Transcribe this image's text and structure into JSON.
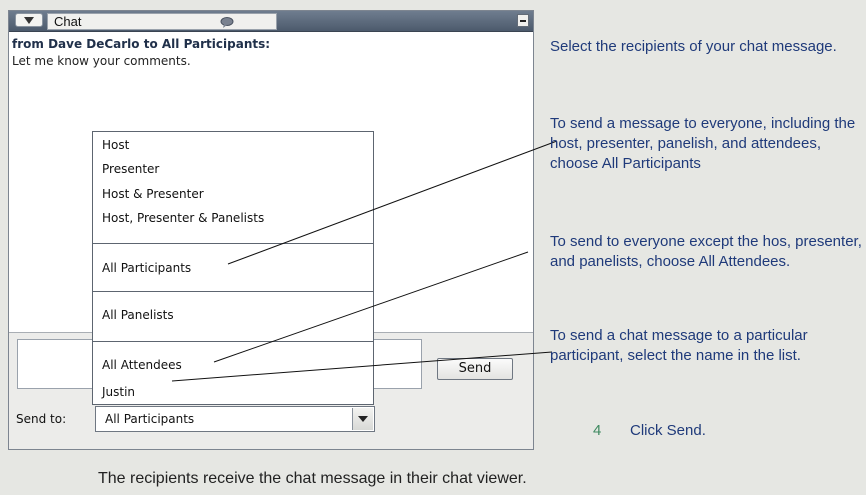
{
  "chat": {
    "title": "Chat",
    "message_sender": "from Dave DeCarlo to All Participants:",
    "message_text": "Let me know your comments.",
    "compose_value": "",
    "send_label": "Send",
    "send_to_label": "Send to:",
    "send_to_value": "All Participants"
  },
  "dropdown": {
    "groups": [
      [
        "Host",
        "Presenter",
        "Host & Presenter",
        "Host, Presenter & Panelists"
      ],
      [
        "All Participants"
      ],
      [
        "All Panelists"
      ],
      [
        "All Attendees",
        "Justin"
      ]
    ]
  },
  "notes": {
    "select_recipients": "Select the recipients of your chat message.",
    "everyone": "To send a message to everyone, including the host, presenter, panelish, and attendees, choose All Participants",
    "attendees": "To send to everyone except the hos, presenter, and panelists, choose All Attendees.",
    "particular": "To send a chat message to a particular participant, select the name in the list.",
    "step_number": "4",
    "step_text": "Click Send."
  },
  "caption": "The recipients receive the chat message in their chat viewer.",
  "icons": {
    "collapse": "triangle-down-icon",
    "bubble": "chat-bubble-icon",
    "minimize": "minimize-icon",
    "dropdown": "chevron-down-icon"
  },
  "colors": {
    "note_text": "#1f3a7a",
    "step_number": "#3f8a60",
    "titlebar": "#5d6b7d"
  }
}
